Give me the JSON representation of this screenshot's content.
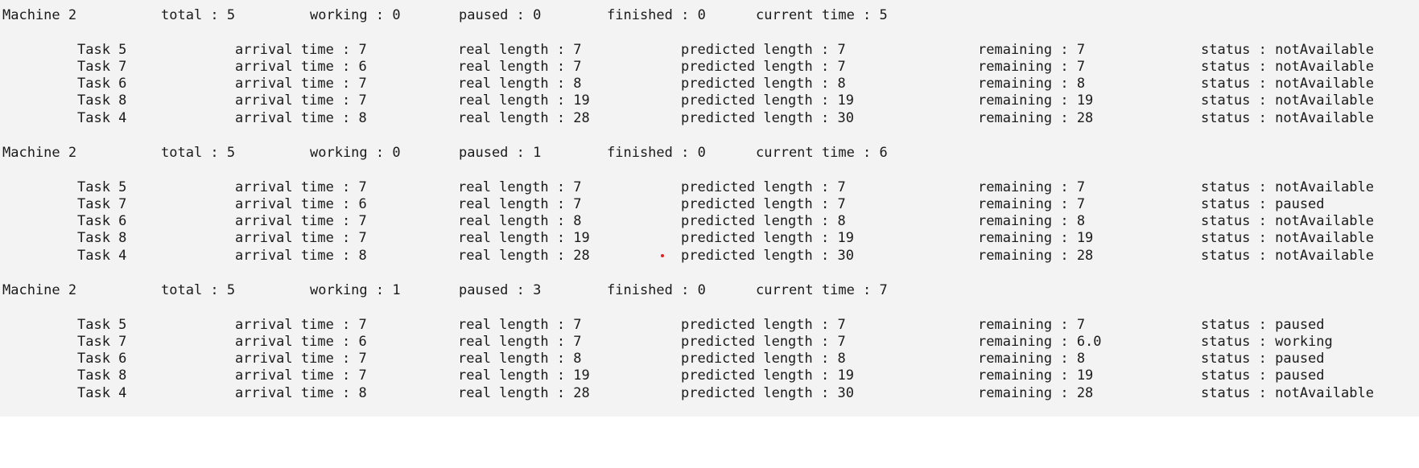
{
  "blocks": [
    {
      "header": {
        "machine": "Machine 2",
        "total": "total : 5",
        "working": "working : 0",
        "paused": "paused : 0",
        "finished": "finished : 0",
        "current_time": "current time : 5"
      },
      "tasks": [
        {
          "name": "Task 5",
          "arrival": "arrival time : 7",
          "real": "real length : 7",
          "predicted": "predicted length : 7",
          "remaining": "remaining : 7",
          "status": "status : notAvailable"
        },
        {
          "name": "Task 7",
          "arrival": "arrival time : 6",
          "real": "real length : 7",
          "predicted": "predicted length : 7",
          "remaining": "remaining : 7",
          "status": "status : notAvailable"
        },
        {
          "name": "Task 6",
          "arrival": "arrival time : 7",
          "real": "real length : 8",
          "predicted": "predicted length : 8",
          "remaining": "remaining : 8",
          "status": "status : notAvailable"
        },
        {
          "name": "Task 8",
          "arrival": "arrival time : 7",
          "real": "real length : 19",
          "predicted": "predicted length : 19",
          "remaining": "remaining : 19",
          "status": "status : notAvailable"
        },
        {
          "name": "Task 4",
          "arrival": "arrival time : 8",
          "real": "real length : 28",
          "predicted": "predicted length : 30",
          "remaining": "remaining : 28",
          "status": "status : notAvailable"
        }
      ]
    },
    {
      "header": {
        "machine": "Machine 2",
        "total": "total : 5",
        "working": "working : 0",
        "paused": "paused : 1",
        "finished": "finished : 0",
        "current_time": "current time : 6"
      },
      "tasks": [
        {
          "name": "Task 5",
          "arrival": "arrival time : 7",
          "real": "real length : 7",
          "predicted": "predicted length : 7",
          "remaining": "remaining : 7",
          "status": "status : notAvailable"
        },
        {
          "name": "Task 7",
          "arrival": "arrival time : 6",
          "real": "real length : 7",
          "predicted": "predicted length : 7",
          "remaining": "remaining : 7",
          "status": "status : paused"
        },
        {
          "name": "Task 6",
          "arrival": "arrival time : 7",
          "real": "real length : 8",
          "predicted": "predicted length : 8",
          "remaining": "remaining : 8",
          "status": "status : notAvailable"
        },
        {
          "name": "Task 8",
          "arrival": "arrival time : 7",
          "real": "real length : 19",
          "predicted": "predicted length : 19",
          "remaining": "remaining : 19",
          "status": "status : notAvailable"
        },
        {
          "name": "Task 4",
          "arrival": "arrival time : 8",
          "real": "real length : 28",
          "predicted": "predicted length : 30",
          "remaining": "remaining : 28",
          "status": "status : notAvailable"
        }
      ]
    },
    {
      "header": {
        "machine": "Machine 2",
        "total": "total : 5",
        "working": "working : 1",
        "paused": "paused : 3",
        "finished": "finished : 0",
        "current_time": "current time : 7"
      },
      "tasks": [
        {
          "name": "Task 5",
          "arrival": "arrival time : 7",
          "real": "real length : 7",
          "predicted": "predicted length : 7",
          "remaining": "remaining : 7",
          "status": "status : paused"
        },
        {
          "name": "Task 7",
          "arrival": "arrival time : 6",
          "real": "real length : 7",
          "predicted": "predicted length : 7",
          "remaining": "remaining : 6.0",
          "status": "status : working"
        },
        {
          "name": "Task 6",
          "arrival": "arrival time : 7",
          "real": "real length : 8",
          "predicted": "predicted length : 8",
          "remaining": "remaining : 8",
          "status": "status : paused"
        },
        {
          "name": "Task 8",
          "arrival": "arrival time : 7",
          "real": "real length : 19",
          "predicted": "predicted length : 19",
          "remaining": "remaining : 19",
          "status": "status : paused"
        },
        {
          "name": "Task 4",
          "arrival": "arrival time : 8",
          "real": "real length : 28",
          "predicted": "predicted length : 30",
          "remaining": "remaining : 28",
          "status": "status : notAvailable"
        }
      ]
    }
  ],
  "colors": {
    "console_bg": "#f3f3f3",
    "text": "#1a1a1a",
    "cursor_dot": "#e02020"
  }
}
